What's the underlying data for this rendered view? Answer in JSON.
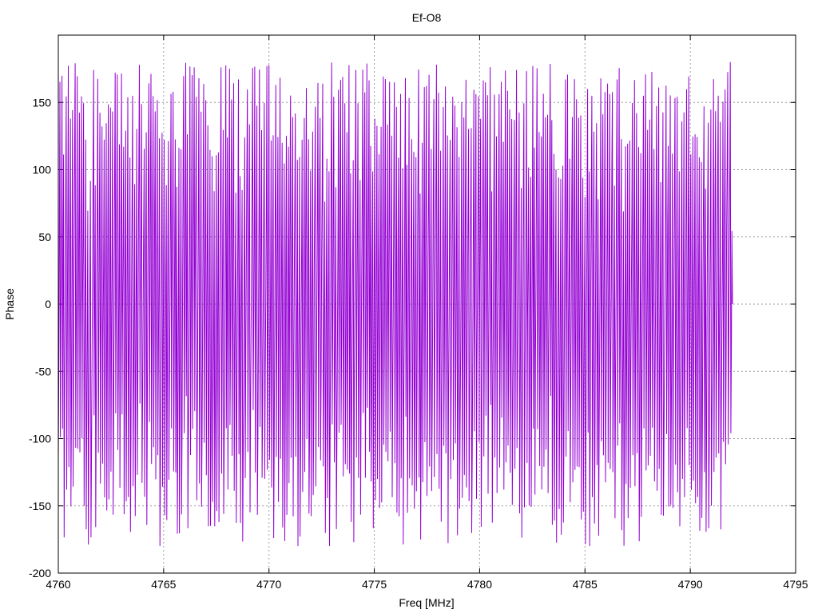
{
  "chart_data": {
    "type": "line",
    "title": "Ef-O8",
    "xlabel": "Freq [MHz]",
    "ylabel": "Phase",
    "xlim": [
      4760,
      4795
    ],
    "ylim": [
      -200,
      200
    ],
    "xticks": [
      4760,
      4765,
      4770,
      4775,
      4780,
      4785,
      4790,
      4795
    ],
    "yticks": [
      -200,
      -150,
      -100,
      -50,
      0,
      50,
      100,
      150
    ],
    "grid": true,
    "legend": "none",
    "series": [
      {
        "color": "#9400d3",
        "x_start": 4760.0,
        "x_end": 4792.0,
        "x_step": 0.025,
        "phase_range": [
          -180,
          180
        ],
        "wrapping": true,
        "samples": [
          {
            "x": 4760.0,
            "y": 150
          },
          {
            "x": 4760.1,
            "y": 120
          },
          {
            "x": 4760.2,
            "y": -20
          },
          {
            "x": 4761.0,
            "y": 155
          },
          {
            "x": 4762.0,
            "y": -170
          },
          {
            "x": 4765.0,
            "y": 175
          },
          {
            "x": 4770.0,
            "y": -160
          },
          {
            "x": 4775.0,
            "y": 170
          },
          {
            "x": 4780.0,
            "y": -165
          },
          {
            "x": 4785.0,
            "y": 160
          },
          {
            "x": 4790.0,
            "y": -175
          },
          {
            "x": 4791.5,
            "y": 170
          },
          {
            "x": 4791.8,
            "y": 155
          },
          {
            "x": 4792.0,
            "y": 0
          }
        ]
      }
    ]
  }
}
